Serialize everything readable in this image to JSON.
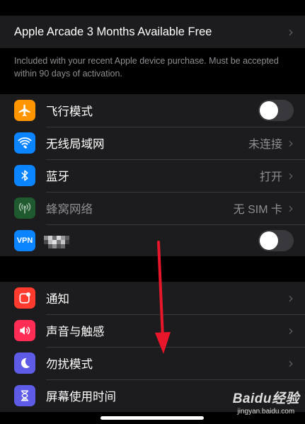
{
  "arcade": {
    "title": "Apple Arcade 3 Months Available Free",
    "note": "Included with your recent Apple device purchase. Must be accepted within 90 days of activation."
  },
  "network": {
    "items": [
      {
        "label": "飞行模式",
        "control": "toggle",
        "on": false,
        "icon": "airplane-icon",
        "icon_color": "#ff9500"
      },
      {
        "label": "无线局域网",
        "value": "未连接",
        "control": "chevron",
        "icon": "wifi-icon",
        "icon_color": "#0a84ff"
      },
      {
        "label": "蓝牙",
        "value": "打开",
        "control": "chevron",
        "icon": "bluetooth-icon",
        "icon_color": "#0a84ff"
      },
      {
        "label": "蜂窝网络",
        "value": "无 SIM 卡",
        "control": "chevron",
        "icon": "cellular-icon",
        "icon_color": "#1f5a2e",
        "dimmed": true
      },
      {
        "label": "",
        "badge": "VPN",
        "control": "toggle",
        "on": false,
        "icon": "vpn-icon",
        "icon_color": "#0a84ff",
        "label_obscured": true
      }
    ]
  },
  "notifications": {
    "items": [
      {
        "label": "通知",
        "control": "chevron",
        "icon": "notification-icon",
        "icon_color": "#ff3b30"
      },
      {
        "label": "声音与触感",
        "control": "chevron",
        "icon": "sound-icon",
        "icon_color": "#ff2d55"
      },
      {
        "label": "勿扰模式",
        "control": "chevron",
        "icon": "moon-icon",
        "icon_color": "#5e5ce6"
      },
      {
        "label": "屏幕使用时间",
        "control": "chevron",
        "icon": "hourglass-icon",
        "icon_color": "#5e5ce6"
      }
    ]
  },
  "annotation": {
    "arrow_color": "#e8162b"
  },
  "watermark": {
    "logo_text": "Baidu经验",
    "url": "jingyan.baidu.com"
  },
  "colors": {
    "background": "#000000",
    "cell": "#1c1c1e",
    "separator": "#38383a",
    "secondary_text": "#8e8e93"
  }
}
